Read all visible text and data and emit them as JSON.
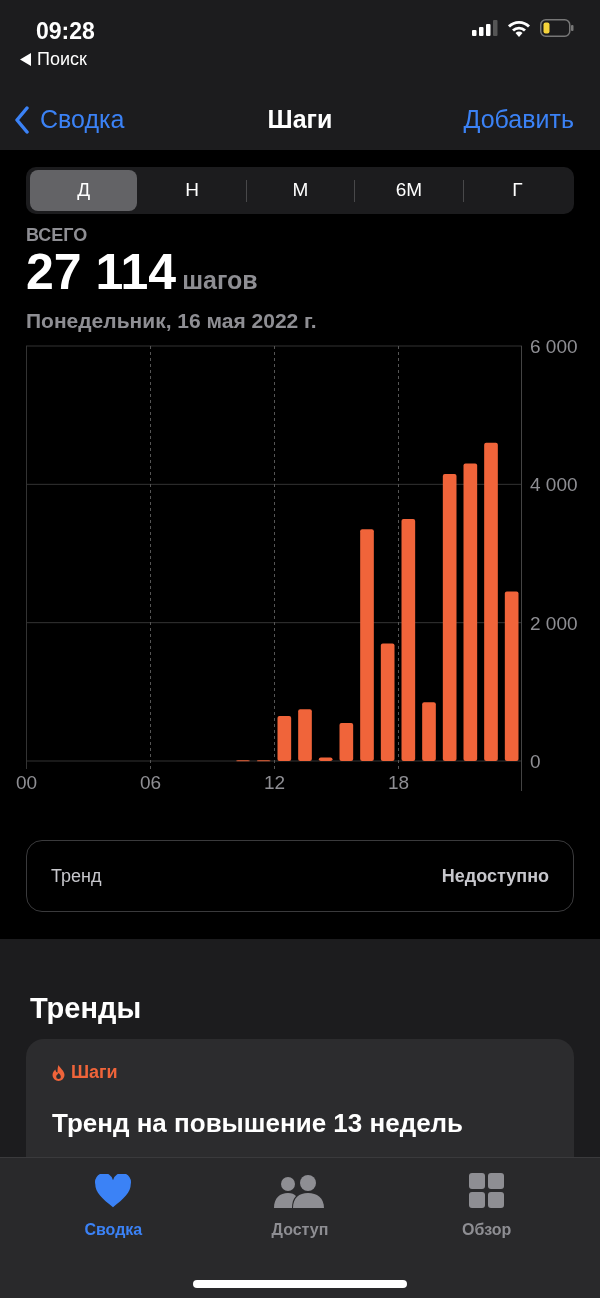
{
  "status_bar": {
    "time": "09:28",
    "back_app": "Поиск"
  },
  "nav": {
    "back": "Сводка",
    "title": "Шаги",
    "action": "Добавить"
  },
  "segments": [
    {
      "label": "Д",
      "selected": true
    },
    {
      "label": "Н",
      "selected": false
    },
    {
      "label": "М",
      "selected": false
    },
    {
      "label": "6М",
      "selected": false
    },
    {
      "label": "Г",
      "selected": false
    }
  ],
  "summary": {
    "label": "ВСЕГО",
    "value": "27 114",
    "unit": "шагов",
    "date": "Понедельник, 16 мая 2022 г."
  },
  "chart_data": {
    "type": "bar",
    "x": [
      10.5,
      11.5,
      12.5,
      13.5,
      14.5,
      15.5,
      16.5,
      17.5,
      18.5,
      19.5,
      20.5,
      21.5,
      22.5,
      23.5
    ],
    "series": [
      {
        "color": "#f0643a",
        "values": [
          10,
          10,
          650,
          750,
          50,
          550,
          3350,
          1700,
          3500,
          850,
          4150,
          4300,
          4600,
          2450
        ]
      }
    ],
    "xlim": [
      0,
      24
    ],
    "grid": true,
    "ylim": [
      0,
      6000
    ],
    "xticks": [
      {
        "value": 0,
        "label": "00"
      },
      {
        "value": 6,
        "label": "06"
      },
      {
        "value": 12,
        "label": "12"
      },
      {
        "value": 18,
        "label": "18"
      }
    ],
    "yticks": [
      {
        "value": 0,
        "label": "0"
      },
      {
        "value": 2000,
        "label": "2 000"
      },
      {
        "value": 4000,
        "label": "4 000"
      },
      {
        "value": 6000,
        "label": "6 000"
      }
    ]
  },
  "trend_row": {
    "label": "Тренд",
    "value": "Недоступно"
  },
  "trends": {
    "title": "Тренды",
    "card": {
      "category": "Шаги",
      "text": "Тренд на повышение 13 недель"
    }
  },
  "tab_bar": [
    {
      "label": "Сводка",
      "kind": "heart",
      "selected": true
    },
    {
      "label": "Доступ",
      "kind": "people",
      "selected": false
    },
    {
      "label": "Обзор",
      "kind": "grid",
      "selected": false
    }
  ]
}
